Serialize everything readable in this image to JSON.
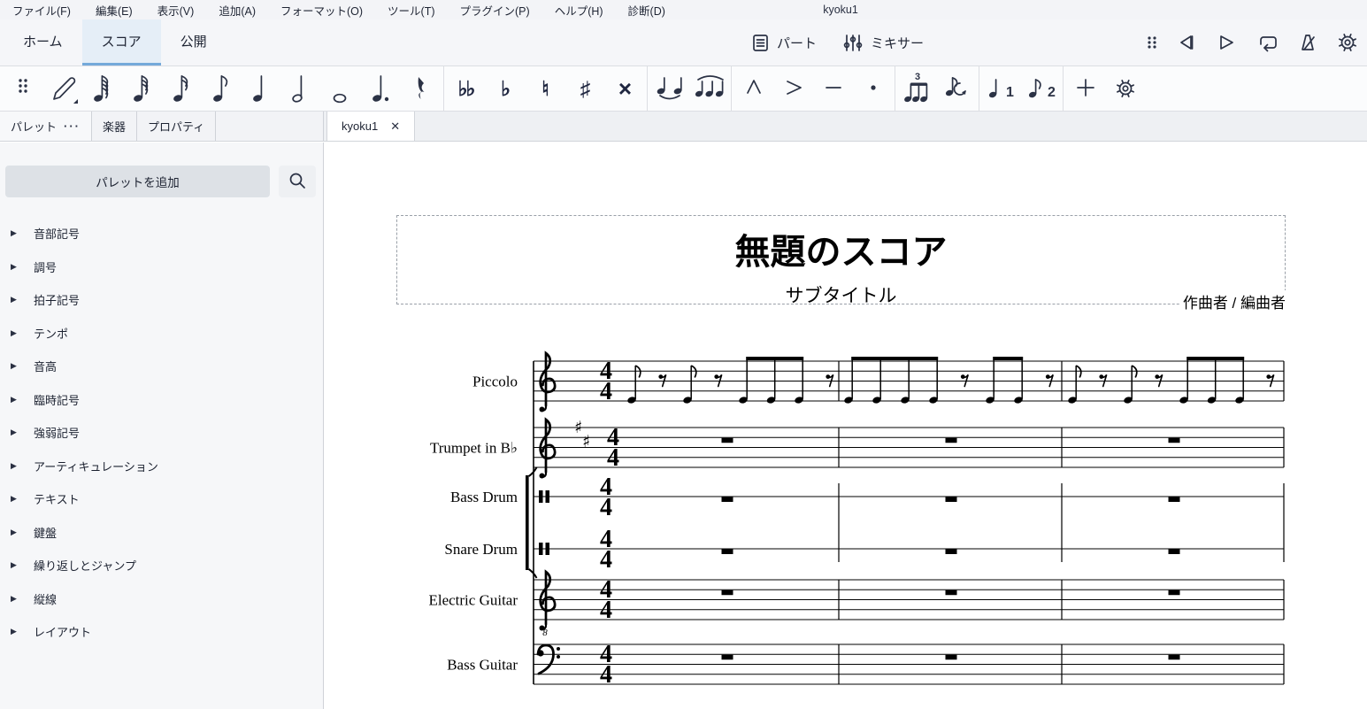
{
  "menu_bar": {
    "items": [
      "ファイル(F)",
      "編集(E)",
      "表示(V)",
      "追加(A)",
      "フォーマット(O)",
      "ツール(T)",
      "プラグイン(P)",
      "ヘルプ(H)",
      "診断(D)"
    ],
    "window_title": "kyoku1"
  },
  "workspace_tabs": {
    "items": [
      "ホーム",
      "スコア",
      "公開"
    ],
    "active": "スコア"
  },
  "top_actions": {
    "parts_label": "パート",
    "mixer_label": "ミキサー"
  },
  "playback_icons": [
    "drag-handle-icon",
    "rewind-icon",
    "play-icon",
    "loop-icon",
    "metronome-icon",
    "playback-settings-gear-icon"
  ],
  "note_toolbar": {
    "icons": [
      "drag-handle",
      "note-input",
      "note-64th",
      "note-32nd",
      "note-16th",
      "note-8th",
      "note-quarter",
      "note-half",
      "note-whole",
      "augmentation-dot",
      "rest",
      "separator",
      "double-flat",
      "flat",
      "natural",
      "sharp",
      "double-sharp",
      "separator",
      "tie",
      "slur",
      "separator",
      "marcato",
      "accent",
      "tenuto",
      "staccato",
      "separator",
      "tuplet",
      "flip-direction",
      "separator",
      "voice-1",
      "voice-2",
      "separator",
      "add",
      "customize"
    ],
    "accidental_glyphs": {
      "double-flat": "♭♭",
      "flat": "♭",
      "natural": "♮",
      "sharp": "♯",
      "double-sharp": "×"
    },
    "voice_numbers": {
      "voice-1": "1",
      "voice-2": "2"
    },
    "tuplet_number": "3"
  },
  "panel": {
    "tabs": [
      "パレット",
      "楽器",
      "プロパティ"
    ],
    "active_tab": "パレット",
    "more_label": "···",
    "add_button": "パレットを追加",
    "items": [
      "音部記号",
      "調号",
      "拍子記号",
      "テンポ",
      "音高",
      "臨時記号",
      "強弱記号",
      "アーティキュレーション",
      "テキスト",
      "鍵盤",
      "繰り返しとジャンプ",
      "縦線",
      "レイアウト"
    ]
  },
  "document_tab": {
    "title": "kyoku1"
  },
  "score": {
    "title": "無題のスコア",
    "subtitle": "サブタイトル",
    "composer": "作曲者 / 編曲者",
    "time_signature": {
      "upper": "4",
      "lower": "4"
    },
    "measures": 3,
    "instruments": [
      {
        "label": "Piccolo",
        "clef": "treble",
        "content": "melody"
      },
      {
        "label": "Trumpet in B♭",
        "clef": "treble",
        "key_sharps": 2,
        "content": "rests"
      },
      {
        "label": "Bass Drum",
        "clef": "percussion",
        "content": "rests"
      },
      {
        "label": "Snare Drum",
        "clef": "percussion",
        "content": "rests"
      },
      {
        "label": "Electric Guitar",
        "clef": "treble-8",
        "octave_mark": "8",
        "content": "rests"
      },
      {
        "label": "Bass Guitar",
        "clef": "bass",
        "content": "rests"
      }
    ],
    "rhythm": [
      [
        "n8",
        "r8",
        "n8",
        "r8",
        "b8",
        "b8",
        "b8",
        "r8"
      ],
      [
        "b8",
        "b8",
        "b8",
        "b8",
        "r8",
        "b8",
        "b8",
        "r8"
      ],
      [
        "n8",
        "r8",
        "n8",
        "r8",
        "b8",
        "b8",
        "b8",
        "r8"
      ]
    ],
    "accent_colors": {
      "tab_highlight": "#e5eef7",
      "tab_underline": "#74a9da",
      "icon_navy": "#2b3245"
    }
  }
}
